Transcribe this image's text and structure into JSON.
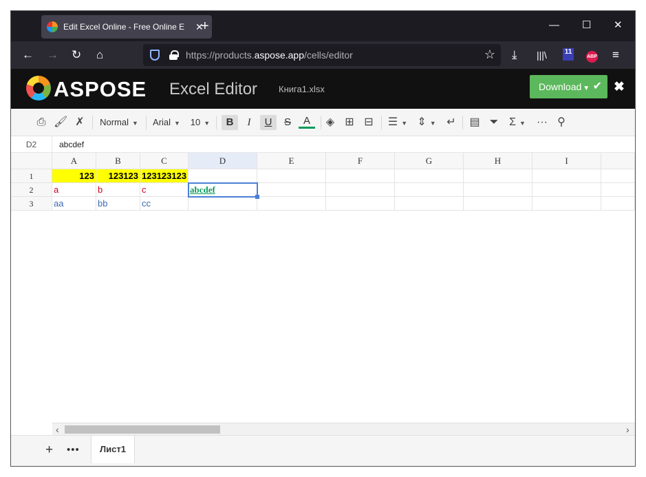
{
  "browser": {
    "tab_title": "Edit Excel Online - Free Online E",
    "tab_close": "✕",
    "new_tab": "+",
    "window_minimize": "—",
    "window_maximize": "☐",
    "window_close": "✕",
    "url_prefix": "https://products.",
    "url_domain": "aspose.app",
    "url_path": "/cells/editor",
    "extension_badge": "11",
    "abp_label": "ABP"
  },
  "header": {
    "logo_text": "ASPOSE",
    "title": "Excel Editor",
    "file_name": "Книга1.xlsx",
    "download_label": "Download",
    "close": "✖"
  },
  "toolbar": {
    "style_select": "Normal",
    "font_select": "Arial",
    "size_select": "10",
    "bold": "B",
    "italic": "I",
    "underline": "U",
    "strike": "S",
    "font_color": "A"
  },
  "formula_bar": {
    "cell_ref": "D2",
    "value": "abcdef"
  },
  "grid": {
    "columns": [
      "A",
      "B",
      "C",
      "D",
      "E",
      "F",
      "G",
      "H",
      "I"
    ],
    "rows": [
      "1",
      "2",
      "3"
    ],
    "cells": {
      "A1": "123",
      "B1": "123123",
      "C1": "123123123",
      "A2": "a",
      "B2": "b",
      "C2": "c",
      "D2": "abcdef",
      "A3": "aa",
      "B3": "bb",
      "C3": "cc"
    },
    "selected_cell": "D2"
  },
  "scrollbar": {
    "left_arrow": "‹",
    "right_arrow": "›"
  },
  "sheets": {
    "add": "+",
    "more": "•••",
    "tabs": [
      "Лист1"
    ]
  },
  "colors": {
    "accent_green": "#5cb85c",
    "highlight_yellow": "#ffff00",
    "text_red": "#d0021b",
    "text_blue": "#3d6bb3",
    "link_green": "#0a9b5a"
  }
}
